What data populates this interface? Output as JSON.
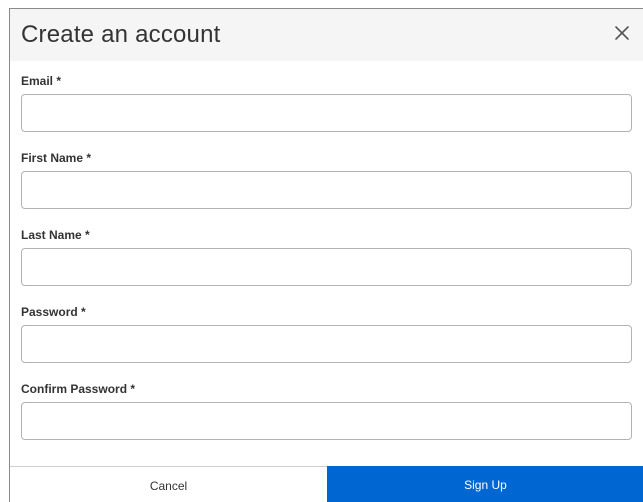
{
  "dialog": {
    "title": "Create an account",
    "close_icon": "close-icon"
  },
  "form": {
    "fields": [
      {
        "label": "Email *",
        "value": "",
        "placeholder": ""
      },
      {
        "label": "First Name *",
        "value": "",
        "placeholder": ""
      },
      {
        "label": "Last Name *",
        "value": "",
        "placeholder": ""
      },
      {
        "label": "Password *",
        "value": "",
        "placeholder": ""
      },
      {
        "label": "Confirm Password *",
        "value": "",
        "placeholder": ""
      }
    ]
  },
  "footer": {
    "cancel_label": "Cancel",
    "signup_label": "Sign Up"
  },
  "colors": {
    "primary": "#0066d2",
    "header_bg": "#f5f5f5",
    "input_border": "#b3b3b3"
  }
}
